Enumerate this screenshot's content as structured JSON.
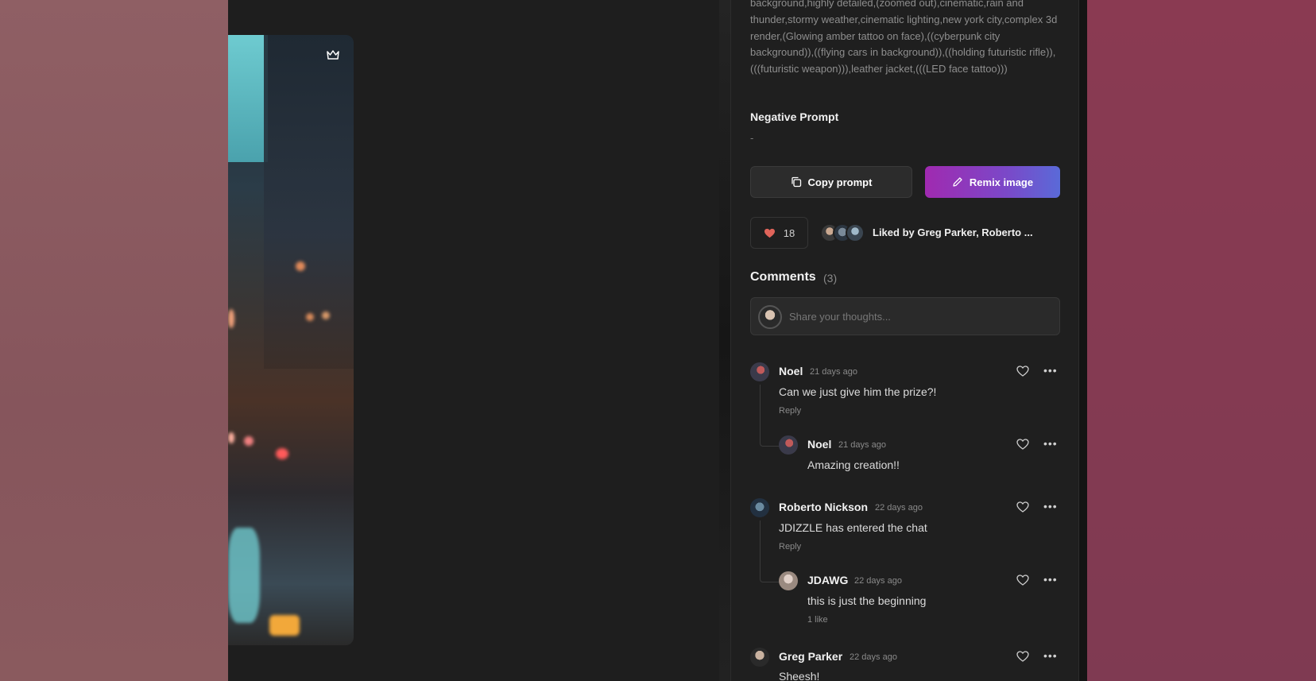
{
  "prompt": {
    "text": "background,highly detailed,(zoomed out),cinematic,rain and thunder,stormy weather,cinematic lighting,new york city,complex 3d render,(Glowing amber tattoo on face),((cyberpunk city background)),((flying cars in background)),((holding futuristic rifle)),(((futuristic weapon))),leather jacket,(((LED face tattoo)))"
  },
  "negative_prompt": {
    "label": "Negative Prompt",
    "value": "-"
  },
  "actions": {
    "copy_label": "Copy prompt",
    "remix_label": "Remix image"
  },
  "likes": {
    "count": "18",
    "liked_by": "Liked by Greg Parker, Roberto ..."
  },
  "comments": {
    "title": "Comments",
    "count": "(3)",
    "input_placeholder": "Share your thoughts...",
    "items": [
      {
        "name": "Noel",
        "time": "21 days ago",
        "text": "Can we just give him the prize?!",
        "reply": "Reply"
      },
      {
        "name": "Noel",
        "time": "21 days ago",
        "text": "Amazing creation!!"
      },
      {
        "name": "Roberto Nickson",
        "time": "22 days ago",
        "text": "JDIZZLE has entered the chat",
        "reply": "Reply"
      },
      {
        "name": "JDAWG",
        "time": "22 days ago",
        "text": "this is just the beginning",
        "likes": "1 like"
      },
      {
        "name": "Greg Parker",
        "time": "22 days ago",
        "text": "Sheesh!"
      }
    ]
  },
  "colors": {
    "accent_start": "#a02ab0",
    "accent_end": "#5a6ad8",
    "heart": "#e0645a"
  },
  "icons": [
    "crown-icon",
    "copy-icon",
    "pencil-icon",
    "heart-icon",
    "more-icon"
  ]
}
